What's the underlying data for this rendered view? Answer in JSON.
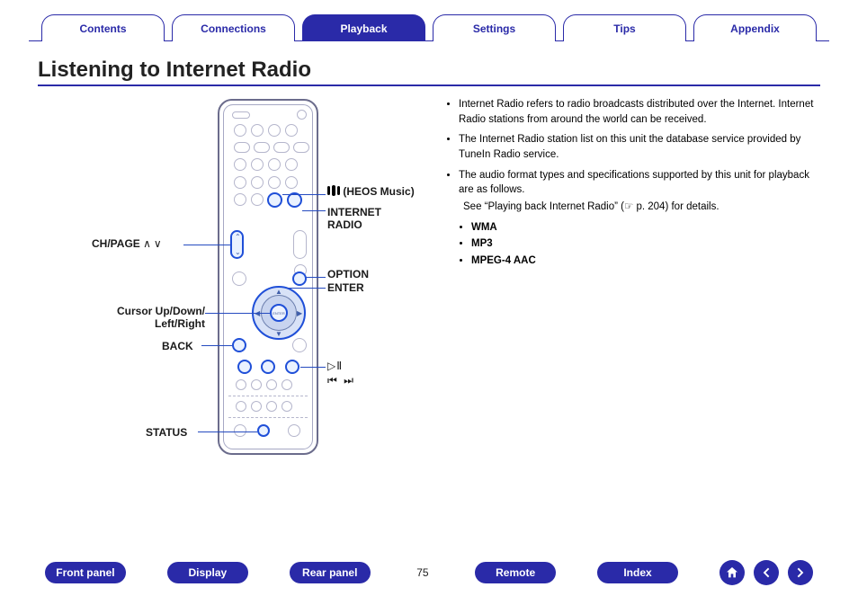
{
  "tabs": {
    "items": [
      "Contents",
      "Connections",
      "Playback",
      "Settings",
      "Tips",
      "Appendix"
    ],
    "active_index": 2
  },
  "title": "Listening to Internet Radio",
  "callouts": {
    "heos": "(HEOS Music)",
    "internet_radio": "INTERNET RADIO",
    "ch_page": "CH/PAGE",
    "ch_page_symbols": "∧∨",
    "option": "OPTION",
    "enter": "ENTER",
    "cursor": "Cursor Up/Down/ Left/Right",
    "back": "BACK",
    "status": "STATUS",
    "transport_symbols_1": "▷Ⅱ",
    "transport_symbols_2": "⏮ ⏭"
  },
  "right_text": {
    "b1": "Internet Radio refers to radio broadcasts distributed over the Internet. Internet Radio stations from around the world can be received.",
    "b2": "The Internet Radio station list on this unit the database service provided by TuneIn Radio service.",
    "b3": "The audio format types and specifications supported by this unit for playback are as follows.",
    "see": "See “Playing back Internet Radio” (☞ p. 204) for details.",
    "formats": [
      "WMA",
      "MP3",
      "MPEG-4 AAC"
    ]
  },
  "footer": {
    "items": [
      "Front panel",
      "Display",
      "Rear panel",
      "Remote",
      "Index"
    ],
    "page": "75"
  },
  "icons": {
    "home": "home-icon",
    "prev": "arrow-left-icon",
    "next": "arrow-right-icon"
  }
}
